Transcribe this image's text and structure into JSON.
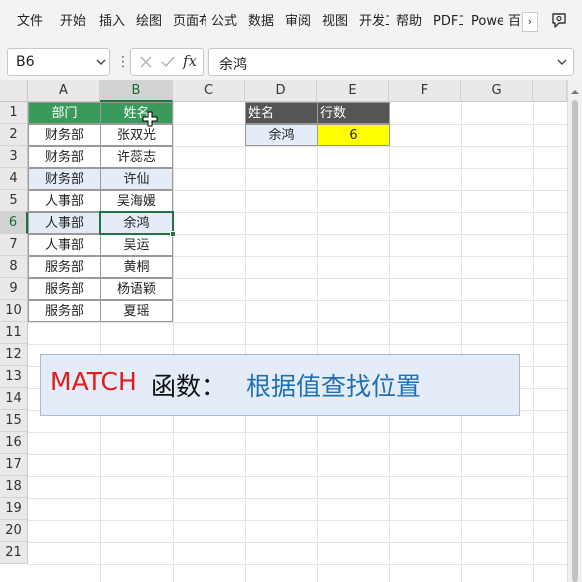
{
  "ribbon": {
    "tabs": [
      "文件",
      "开始",
      "插入",
      "绘图",
      "页面布",
      "公式",
      "数据",
      "审阅",
      "视图",
      "开发工",
      "帮助",
      "PDF工",
      "Power",
      "百"
    ],
    "scroll_glyph": "›"
  },
  "formula_bar": {
    "name_box": "B6",
    "fx_label": "fx",
    "formula_value": "余鸿"
  },
  "grid": {
    "columns": [
      "A",
      "B",
      "C",
      "D",
      "E",
      "F",
      "G"
    ],
    "rows": [
      "1",
      "2",
      "3",
      "4",
      "5",
      "6",
      "7",
      "8",
      "9",
      "10",
      "11",
      "12",
      "13",
      "14",
      "15",
      "16",
      "17",
      "18",
      "19",
      "20",
      "21"
    ],
    "selected_column": "B",
    "selected_row": "6",
    "table1": {
      "headers": [
        "部门",
        "姓名"
      ],
      "rows": [
        [
          "财务部",
          "张双光"
        ],
        [
          "财务部",
          "许蕊志"
        ],
        [
          "财务部",
          "许仙"
        ],
        [
          "人事部",
          "吴海媛"
        ],
        [
          "人事部",
          "余鸿"
        ],
        [
          "人事部",
          "吴运"
        ],
        [
          "服务部",
          "黄桐"
        ],
        [
          "服务部",
          "杨语颖"
        ],
        [
          "服务部",
          "夏瑶"
        ]
      ]
    },
    "table2": {
      "headers": [
        "姓名",
        "行数"
      ],
      "row": [
        "余鸿",
        "6"
      ]
    }
  },
  "banner": {
    "red": "MATCH",
    "black": "函数：",
    "blue": "根据值查找位置"
  },
  "colors": {
    "excel_green": "#217346",
    "header_green": "#3a9a5c",
    "header_dark": "#555555",
    "highlight_yellow": "#ffff00",
    "light_blue": "#e4edf7",
    "banner_red": "#e11b1b",
    "banner_blue": "#1f6fb5"
  },
  "icons": {
    "name_box_dropdown": "chevron-down-icon",
    "cancel": "close-icon",
    "confirm": "check-icon",
    "expand": "chevron-down-icon",
    "ribbon_toggle": "comment-icon",
    "cursor": "plus-cursor-icon"
  }
}
